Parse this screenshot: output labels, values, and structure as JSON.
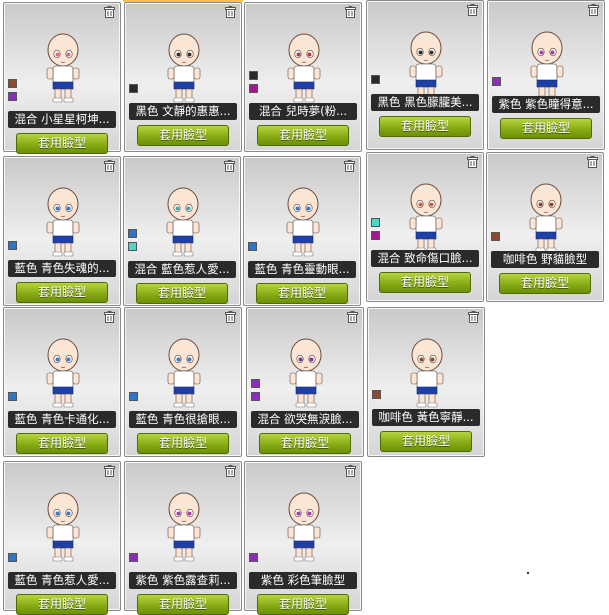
{
  "apply_label": "套用臉型",
  "colors": {
    "brown": "#8b4a32",
    "purple": "#8a2fb8",
    "black": "#2a2a2a",
    "blue": "#2f76c7",
    "cyan": "#4fd6c6",
    "magenta": "#a2168f"
  },
  "cards": [
    {
      "label": "混合 小星星柯坤...",
      "swatches": [
        "#8b4a32",
        "#8a2fb8"
      ],
      "eye": "#d86a8a"
    },
    {
      "label": "黑色 文靜的惠惠...",
      "swatches": [
        "#2a2a2a"
      ],
      "eye": "#333333"
    },
    {
      "label": "混合 兒時夢(粉...",
      "swatches": [
        "#2a2a2a",
        "#a2168f"
      ],
      "eye": "#b04060"
    },
    {
      "label": "黑色 黑色朦朧美...",
      "swatches": [
        "#2a2a2a"
      ],
      "eye": "#333333"
    },
    {
      "label": "紫色 紫色瞳得意...",
      "swatches": [
        "#8a2fb8"
      ],
      "eye": "#a040b0"
    },
    {
      "label": "藍色 青色失魂的...",
      "swatches": [
        "#2f76c7"
      ],
      "eye": "#3a7ac8"
    },
    {
      "label": "混合 藍色惹人愛...",
      "swatches": [
        "#2f76c7",
        "#4fd6c6"
      ],
      "eye": "#3aa8b0"
    },
    {
      "label": "藍色 青色靈動眼...",
      "swatches": [
        "#2f76c7"
      ],
      "eye": "#3a7ac8"
    },
    {
      "label": "混合 致命傷口臉...",
      "swatches": [
        "#4fd6c6",
        "#a2168f"
      ],
      "eye": "#c06040"
    },
    {
      "label": "咖啡色 野貓臉型",
      "swatches": [
        "#8b4a32"
      ],
      "eye": "#8b4a32"
    },
    {
      "label": "藍色 青色卡通化...",
      "swatches": [
        "#2f76c7"
      ],
      "eye": "#3a7ac8"
    },
    {
      "label": "藍色 青色很搶眼...",
      "swatches": [
        "#2f76c7"
      ],
      "eye": "#3a7ac8"
    },
    {
      "label": "混合 欲哭無淚臉...",
      "swatches": [
        "#8a2fb8",
        "#8a2fb8"
      ],
      "eye": "#7a3aa0"
    },
    {
      "label": "咖啡色 黃色寧靜...",
      "swatches": [
        "#8b4a32"
      ],
      "eye": "#8b4a32"
    },
    {
      "label": "藍色 青色惹人愛...",
      "swatches": [
        "#2f76c7"
      ],
      "eye": "#3a7ac8"
    },
    {
      "label": "紫色 紫色露查莉...",
      "swatches": [
        "#8a2fb8"
      ],
      "eye": "#a040b0"
    },
    {
      "label": "紫色 彩色筆臉型",
      "swatches": [
        "#8a2fb8"
      ],
      "eye": "#a040b0"
    }
  ]
}
